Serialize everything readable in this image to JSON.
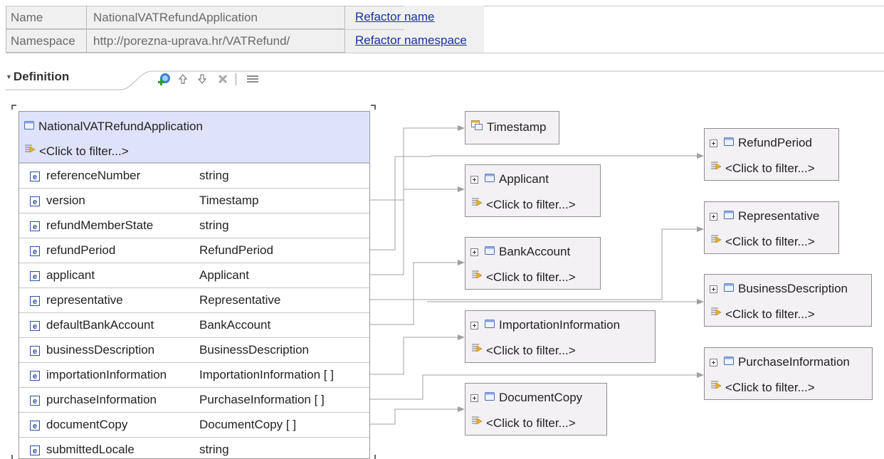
{
  "header": {
    "name_label": "Name",
    "name_value": "NationalVATRefundApplication",
    "refactor_name": "Refactor name",
    "namespace_label": "Namespace",
    "namespace_value": "http://porezna-uprava.hr/VATRefund/",
    "refactor_namespace": "Refactor namespace"
  },
  "section": {
    "title": "Definition",
    "toolbar": [
      "add-element-icon",
      "move-up-icon",
      "move-down-icon",
      "delete-icon",
      "show-properties-icon"
    ]
  },
  "main_type": {
    "name": "NationalVATRefundApplication",
    "filter": "<Click to filter...>",
    "fields": [
      {
        "name": "referenceNumber",
        "type": "string"
      },
      {
        "name": "version",
        "type": "Timestamp"
      },
      {
        "name": "refundMemberState",
        "type": "string"
      },
      {
        "name": "refundPeriod",
        "type": "RefundPeriod"
      },
      {
        "name": "applicant",
        "type": "Applicant"
      },
      {
        "name": "representative",
        "type": "Representative"
      },
      {
        "name": "defaultBankAccount",
        "type": "BankAccount"
      },
      {
        "name": "businessDescription",
        "type": "BusinessDescription"
      },
      {
        "name": "importationInformation",
        "type": "ImportationInformation [ ]"
      },
      {
        "name": "purchaseInformation",
        "type": "PurchaseInformation [ ]"
      },
      {
        "name": "documentCopy",
        "type": "DocumentCopy [ ]"
      },
      {
        "name": "submittedLocale",
        "type": "string"
      }
    ]
  },
  "ref_types": {
    "timestamp": {
      "name": "Timestamp"
    },
    "applicant": {
      "name": "Applicant",
      "filter": "<Click to filter...>"
    },
    "bankaccount": {
      "name": "BankAccount",
      "filter": "<Click to filter...>"
    },
    "importation": {
      "name": "ImportationInformation",
      "filter": "<Click to filter...>"
    },
    "documentcopy": {
      "name": "DocumentCopy",
      "filter": "<Click to filter...>"
    },
    "refundperiod": {
      "name": "RefundPeriod",
      "filter": "<Click to filter...>"
    },
    "representative": {
      "name": "Representative",
      "filter": "<Click to filter...>"
    },
    "businessdescription": {
      "name": "BusinessDescription",
      "filter": "<Click to filter...>"
    },
    "purchaseinformation": {
      "name": "PurchaseInformation",
      "filter": "<Click to filter...>"
    }
  },
  "colors": {
    "link": "#1a2fa8",
    "header_bg": "#dfe3fa",
    "ref_box_bg": "#f4f1f4",
    "element_icon": "#2a4fa0"
  }
}
